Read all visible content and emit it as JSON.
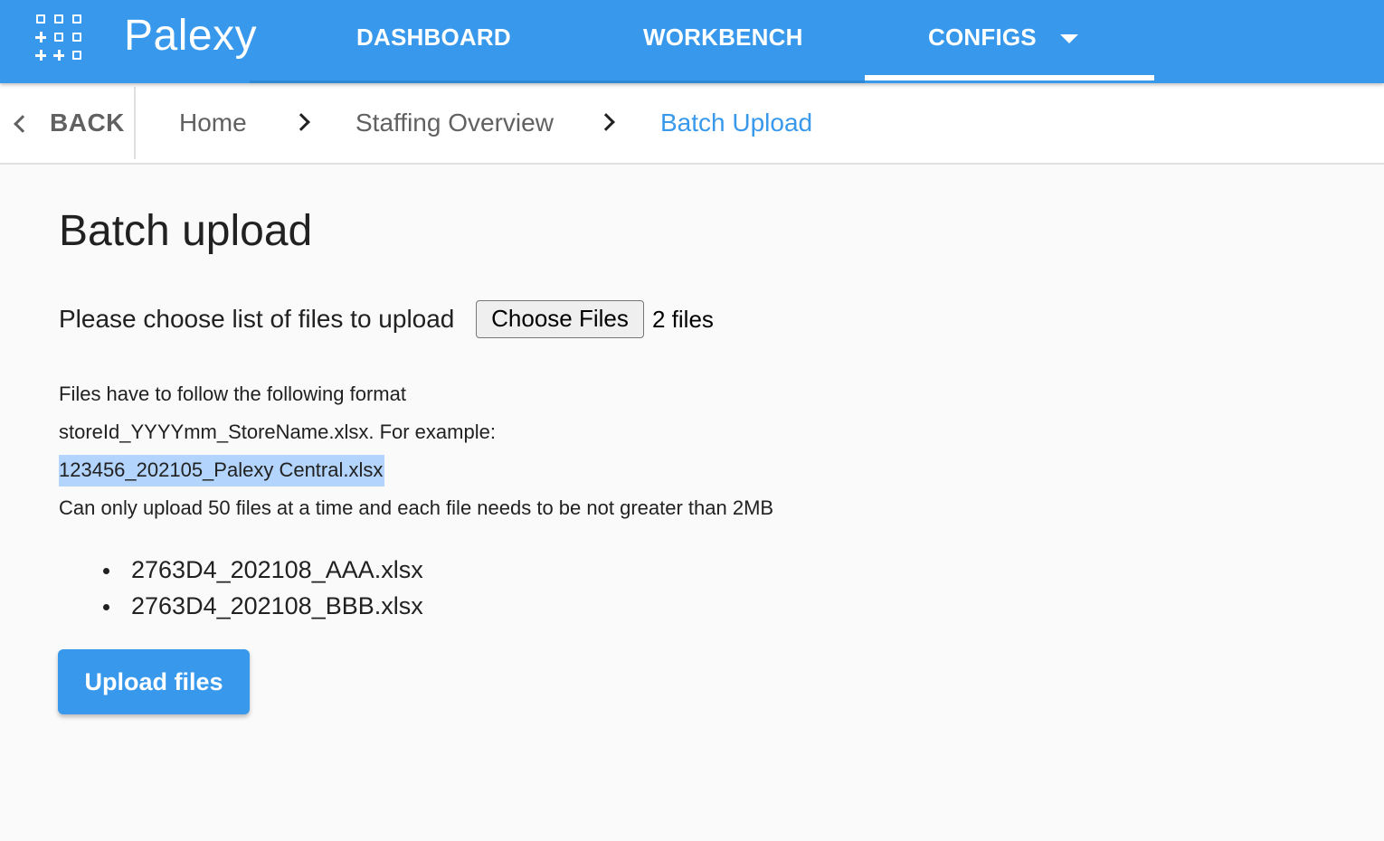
{
  "header": {
    "brand": "Palexy",
    "nav": [
      {
        "label": "DASHBOARD"
      },
      {
        "label": "WORKBENCH"
      },
      {
        "label": "CONFIGS"
      }
    ],
    "colors": {
      "primary": "#3899ec",
      "highlight": "#b3d4fc"
    }
  },
  "breadcrumb": {
    "back_label": "BACK",
    "items": [
      {
        "label": "Home"
      },
      {
        "label": "Staffing Overview"
      },
      {
        "label": "Batch Upload"
      }
    ]
  },
  "main": {
    "title": "Batch upload",
    "choose_label": "Please choose list of files to upload",
    "choose_button": "Choose Files",
    "file_count": "2 files",
    "format_line1": "Files have to follow the following format",
    "format_line2": "storeId_YYYYmm_StoreName.xlsx. For example:",
    "example": "123456_202105_Palexy Central.xlsx",
    "limit_note": "Can only upload 50 files at a time and each file needs to be not greater than 2MB",
    "files": [
      "2763D4_202108_AAA.xlsx",
      "2763D4_202108_BBB.xlsx"
    ],
    "upload_button": "Upload files"
  }
}
